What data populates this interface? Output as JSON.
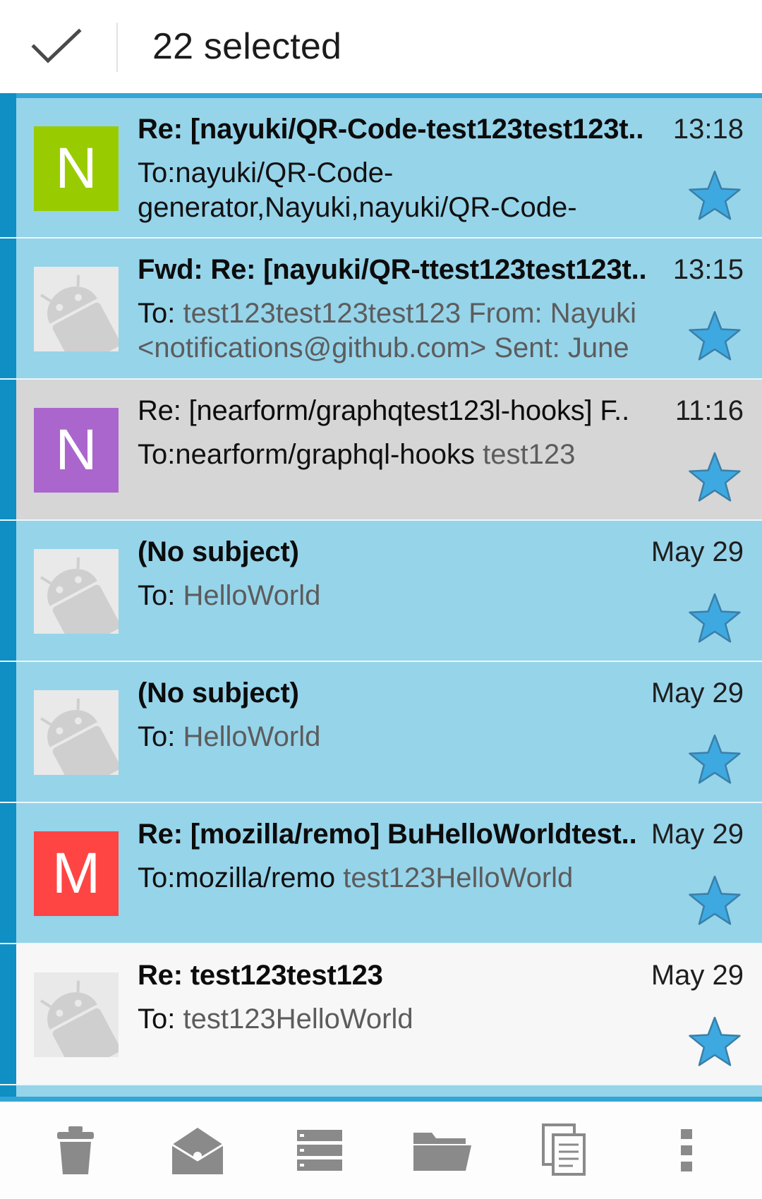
{
  "action_bar": {
    "title": "22 selected",
    "done_icon": "check-icon"
  },
  "colors": {
    "selected_row": "#96d4ea",
    "highlight_row": "#d6d6d6",
    "unselected_row": "#f7f7f7",
    "stripe": "#0f8fc4",
    "star": "#3ea9e0"
  },
  "messages": [
    {
      "avatar_letter": "N",
      "avatar_color": "#99cc00",
      "subject": "Re: [nayuki/QR-Code-test123test123t..",
      "time": "13:18",
      "preview_line1": "To:nayuki/QR-Code-",
      "preview_line2": "generator,Nayuki,nayuki/QR-Code-",
      "starred": true
    },
    {
      "avatar": "android-robot-icon",
      "subject": "Fwd: Re: [nayuki/QR-ttest123test123t..",
      "time": "13:15",
      "preview_prefix": "To: ",
      "preview_line1": "test123test123test123 From: Nayuki",
      "preview_line2": "<notifications@github.com> Sent: June",
      "starred": true
    },
    {
      "avatar_letter": "N",
      "avatar_color": "#aa66cc",
      "subject": "Re: [nearform/graphqtest123l-hooks] F..",
      "time": "11:16",
      "preview_prefix": "To:nearform/graphql-hooks ",
      "preview_line1": "test123",
      "starred": true
    },
    {
      "avatar": "android-robot-icon",
      "subject": "(No subject)",
      "time": "May 29",
      "preview_prefix": "To: ",
      "preview_line1": "HelloWorld",
      "starred": true
    },
    {
      "avatar": "android-robot-icon",
      "subject": "(No subject)",
      "time": "May 29",
      "preview_prefix": "To: ",
      "preview_line1": "HelloWorld",
      "starred": true
    },
    {
      "avatar_letter": "M",
      "avatar_color": "#ff4444",
      "subject": "Re: [mozilla/remo] BuHelloWorldtest..",
      "time": "May 29",
      "preview_prefix": "To:mozilla/remo ",
      "preview_line1": "test123HelloWorld",
      "starred": true
    },
    {
      "avatar": "android-robot-icon",
      "subject": "Re: test123test123",
      "time": "May 29",
      "preview_prefix": "To: ",
      "preview_line1": "test123HelloWorld",
      "starred": true
    }
  ],
  "bottom_bar": [
    {
      "icon": "trash-icon"
    },
    {
      "icon": "mark-read-icon"
    },
    {
      "icon": "move-list-icon"
    },
    {
      "icon": "folder-icon"
    },
    {
      "icon": "copy-icon"
    },
    {
      "icon": "overflow-menu-icon"
    }
  ]
}
